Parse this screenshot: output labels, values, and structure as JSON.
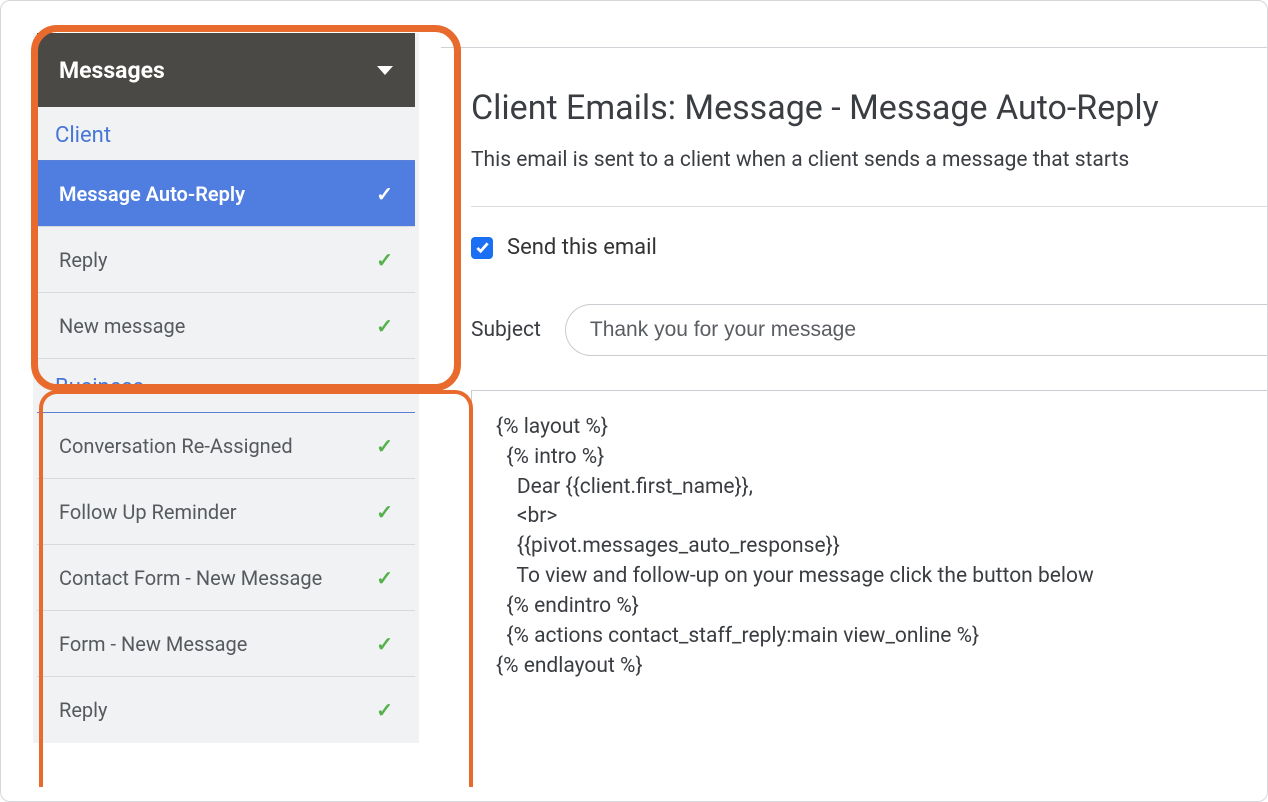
{
  "sidebar": {
    "section_title": "Messages",
    "client_label": "Client",
    "business_label": "Business",
    "client_items": [
      {
        "label": "Message Auto-Reply",
        "active": true
      },
      {
        "label": "Reply",
        "active": false
      },
      {
        "label": "New message",
        "active": false
      }
    ],
    "business_items": [
      {
        "label": "Conversation Re-Assigned"
      },
      {
        "label": "Follow Up Reminder"
      },
      {
        "label": "Contact Form - New Message"
      },
      {
        "label": "Form - New Message"
      },
      {
        "label": "Reply"
      }
    ]
  },
  "main": {
    "title": "Client Emails: Message - Message Auto-Reply",
    "description": "This email is sent to a client when a client sends a message that starts",
    "send_label": "Send this email",
    "send_checked": true,
    "subject_label": "Subject",
    "subject_value": "Thank you for your message",
    "body": "{% layout %}\n  {% intro %}\n    Dear {{client.first_name}},\n    <br>\n    {{pivot.messages_auto_response}}\n    To view and follow-up on your message click the button below\n  {% endintro %}\n  {% actions contact_staff_reply:main view_online %}\n{% endlayout %}"
  },
  "colors": {
    "accent": "#4f7de0",
    "highlight": "#e86a2c",
    "checkbox": "#1b6ff2",
    "green": "#56b14c"
  }
}
